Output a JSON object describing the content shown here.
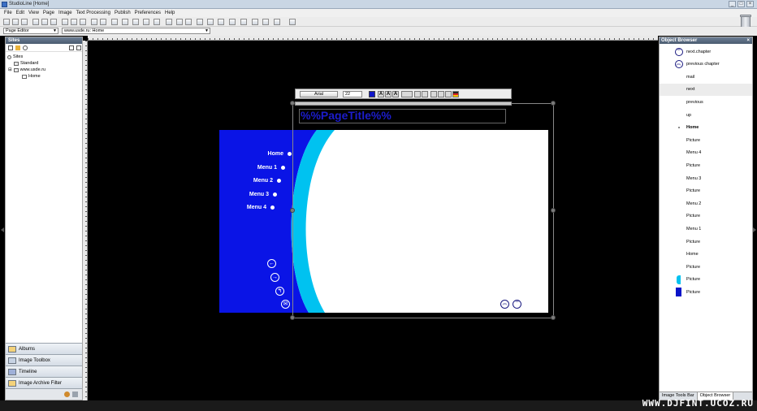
{
  "window": {
    "title": "StudioLine [Home]",
    "buttons": [
      "_",
      "□",
      "×"
    ]
  },
  "menu": [
    "File",
    "Edit",
    "View",
    "Page",
    "Image",
    "Text Processing",
    "Publish",
    "Preferences",
    "Help"
  ],
  "address": {
    "mode": "Page Editor",
    "path": "www.usde.ru: Home"
  },
  "sites_panel": {
    "title": "Sites",
    "tree": [
      {
        "label": "Sites",
        "indent": 0
      },
      {
        "label": "Standard",
        "indent": 1
      },
      {
        "label": "www.usde.ru",
        "indent": 1
      },
      {
        "label": "Home",
        "indent": 2
      }
    ],
    "bottom_items": [
      "Albums",
      "Image Toolbox",
      "Timeline",
      "Image Archive Filter"
    ]
  },
  "editor": {
    "text_toolbar": {
      "font": "Arial",
      "size": "22",
      "color": "#1016c8"
    },
    "page_title_placeholder": "%%PageTitle%%",
    "nav": [
      "Home",
      "Menu 1",
      "Menu 2",
      "Menu 3",
      "Menu 4"
    ],
    "colors": {
      "blue": "#0a14e6",
      "cyan": "#00c2f0"
    }
  },
  "object_browser": {
    "title": "Object Browser",
    "close": "×",
    "items": [
      {
        "label": "next.chapter",
        "thumb": "chevrons-down",
        "bold": false,
        "highlight": false
      },
      {
        "label": "previous chapter",
        "thumb": "chevrons-up",
        "bold": false,
        "highlight": false
      },
      {
        "label": "mail",
        "thumb": "none",
        "bold": false,
        "highlight": false
      },
      {
        "label": "next",
        "thumb": "none",
        "bold": false,
        "highlight": true
      },
      {
        "label": "previous",
        "thumb": "none",
        "bold": false,
        "highlight": false
      },
      {
        "label": "up",
        "thumb": "none",
        "bold": false,
        "highlight": false
      },
      {
        "label": "Home",
        "thumb": "dot",
        "bold": true,
        "highlight": false
      },
      {
        "label": "Picture",
        "thumb": "none",
        "bold": false,
        "highlight": false
      },
      {
        "label": "Menu 4",
        "thumb": "none",
        "bold": false,
        "highlight": false
      },
      {
        "label": "Picture",
        "thumb": "none",
        "bold": false,
        "highlight": false
      },
      {
        "label": "Menu 3",
        "thumb": "none",
        "bold": false,
        "highlight": false
      },
      {
        "label": "Picture",
        "thumb": "none",
        "bold": false,
        "highlight": false
      },
      {
        "label": "Menu 2",
        "thumb": "none",
        "bold": false,
        "highlight": false
      },
      {
        "label": "Picture",
        "thumb": "none",
        "bold": false,
        "highlight": false
      },
      {
        "label": "Menu 1",
        "thumb": "none",
        "bold": false,
        "highlight": false
      },
      {
        "label": "Picture",
        "thumb": "none",
        "bold": false,
        "highlight": false
      },
      {
        "label": "Home",
        "thumb": "none",
        "bold": false,
        "highlight": false
      },
      {
        "label": "Picture",
        "thumb": "none",
        "bold": false,
        "highlight": false
      },
      {
        "label": "Picture",
        "thumb": "cyan",
        "bold": false,
        "highlight": false
      },
      {
        "label": "Picture",
        "thumb": "blue",
        "bold": false,
        "highlight": false
      }
    ],
    "tabs": [
      "Image Tools Bar",
      "Object Browser"
    ]
  },
  "watermark": "WWW.DJFINT.UCOZ.RU"
}
